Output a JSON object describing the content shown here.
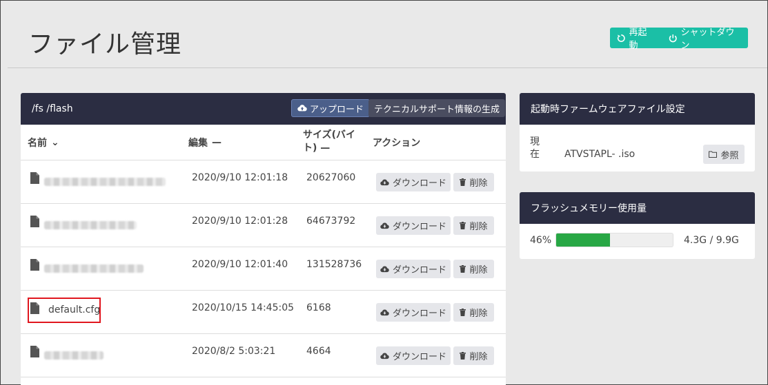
{
  "page": {
    "title": "ファイル管理",
    "restart_label": "再起動",
    "shutdown_label": "シャットダウン"
  },
  "files_panel": {
    "path": "/fs /flash",
    "upload_label": "アップロード",
    "techsupport_label": "テクニカルサポート情報の生成",
    "columns": {
      "name": "名前",
      "name_sort": "⌄",
      "edit": "編集",
      "edit_sort": "—",
      "size_line1": "サイズ(バイ",
      "size_line2": "ト)",
      "size_sort": "—",
      "action": "アクション"
    },
    "download_label": "ダウンロード",
    "delete_label": "削除",
    "rows": [
      {
        "name": "",
        "date": "2020/9/10 12:01:18",
        "size": "20627060"
      },
      {
        "name": "",
        "date": "2020/9/10 12:01:28",
        "size": "64673792"
      },
      {
        "name": "",
        "date": "2020/9/10 12:01:40",
        "size": "131528736"
      },
      {
        "name": "default.cfg",
        "date": "2020/10/15 14:45:05",
        "size": "6168"
      },
      {
        "name": "",
        "date": "2020/8/2 5:03:21",
        "size": "4664"
      }
    ]
  },
  "boot_panel": {
    "title": "起動時ファームウェアファイル設定",
    "current_label": "現在",
    "current_file": "ATVSTAPL-       .iso",
    "browse_label": "参照"
  },
  "flash_panel": {
    "title": "フラッシュメモリー使用量",
    "percent_label": "46%",
    "percent_value": 46,
    "usage": "4.3G / 9.9G",
    "bar_color": "#28a745"
  },
  "colors": {
    "accent": "#1bbfa6",
    "panel_header": "#2b2d42",
    "highlight": "#e0161e"
  }
}
